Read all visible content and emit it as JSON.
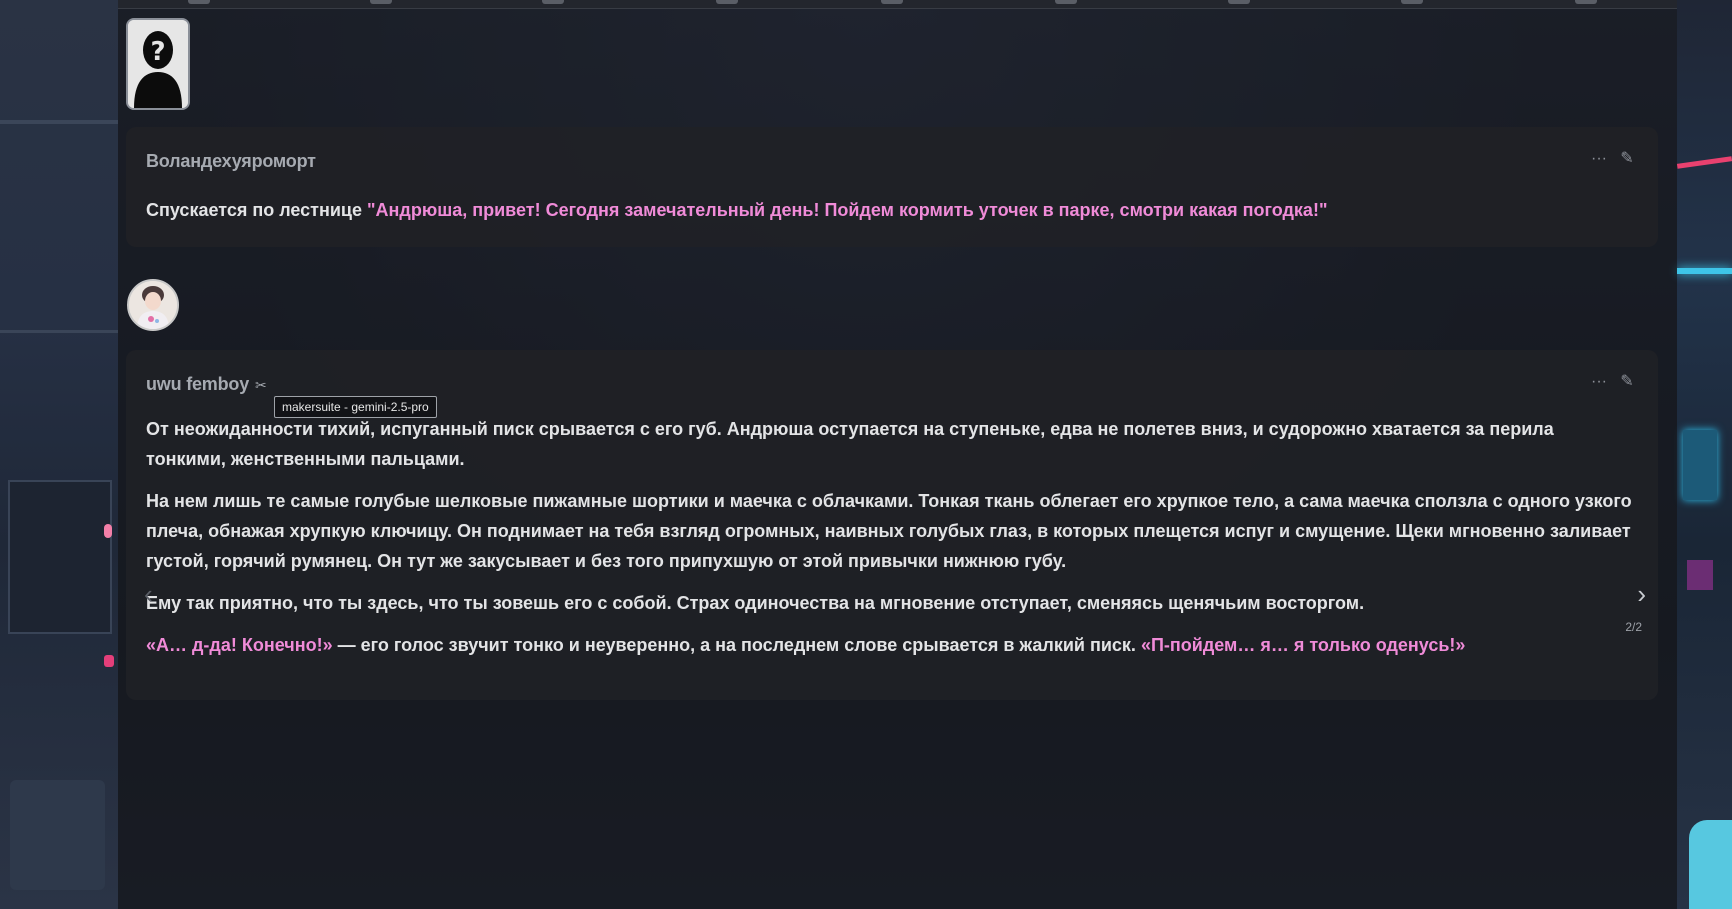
{
  "messages": [
    {
      "author": "Воландехуяроморт",
      "segments": {
        "narration": "Спускается по лестнице ",
        "quote": "\"Андрюша, привет! Сегодня замечательный день! Пойдем кормить уточек в парке, смотри какая погодка!\""
      }
    },
    {
      "author": "uwu femboy",
      "author_icon": "bot-icon",
      "tooltip": "makersuite - gemini-2.5-pro",
      "paragraphs": [
        "От неожиданности тихий, испуганный писк срывается с его губ. Андрюша оступается на ступеньке, едва не полетев вниз, и судорожно хватается за перила тонкими, женственными пальцами.",
        "На нем лишь те самые голубые шелковые пижамные шортики и маечка с облачками. Тонкая ткань облегает его хрупкое тело, а сама маечка сползла с одного узкого плеча, обнажая хрупкую ключицу. Он поднимает на тебя взгляд огромных, наивных голубых глаз, в которых плещется испуг и смущение. Щеки мгновенно заливает густой, горячий румянец. Он тут же закусывает и без того припухшую от этой привычки нижнюю губу.",
        "Ему так приятно, что ты здесь, что ты зовешь его с собой. Страх одиночества на мгновение отступает, сменяясь щенячьим восторгом."
      ],
      "last_paragraph": {
        "quote1": "«А… д-да! Конечно!»",
        "narration": " — его голос звучит тонко и неуверенно, а на последнем слове срывается в жалкий писк. ",
        "quote2": "«П-пойдем… я… я только оденусь!»"
      },
      "swipe_counter": "2/2"
    }
  ],
  "icons": {
    "more": "ellipsis-icon",
    "edit": "pencil-icon",
    "swipe_left": "chevron-left-icon",
    "swipe_right": "chevron-right-icon"
  },
  "colors": {
    "quote": "#f08bd8",
    "text": "#e3e4e6",
    "name": "#a6aab1",
    "message_bg": "#202125"
  }
}
